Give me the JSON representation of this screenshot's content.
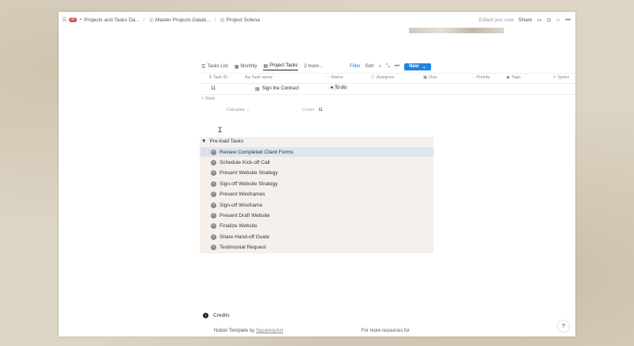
{
  "topbar": {
    "badge": "99",
    "crumb1": "Projects and Tasks Da...",
    "crumb2": "Master Projects Datab...",
    "crumb3": "Project Solena",
    "edited": "Edited just now",
    "share": "Share"
  },
  "tabs": {
    "items": [
      "Tasks List",
      "Monthly",
      "Project Tasks"
    ],
    "more": "2 more...",
    "filter": "Filter",
    "sort": "Sort",
    "new": "New"
  },
  "table": {
    "headers": [
      "Task ID",
      "Aa Task name",
      "Status",
      "Assignee",
      "Due",
      "Priority",
      "Tags",
      "Sprint"
    ],
    "row": {
      "id": "11",
      "name": "Sign the Contract",
      "status": "To do"
    },
    "add_new": "+ New",
    "calculate": "Calculate",
    "count_label": "COUNT",
    "count_value": "11"
  },
  "group": {
    "title": "Pre-load Tasks",
    "tasks": [
      "Review Completed Client Forms",
      "Schedule Kick-off Call",
      "Present Website Strategy",
      "Sign-off Website Strategy",
      "Present Wireframes",
      "Sign-off Wireframe",
      "Present Draft Website",
      "Finalize Website",
      "Share Hand-off Guide",
      "Testimonial Request"
    ]
  },
  "credits": {
    "title": "Credits",
    "template_by": "Notion Template by",
    "author": "SquarespAxI",
    "more": "For more resources for"
  },
  "help": "?"
}
